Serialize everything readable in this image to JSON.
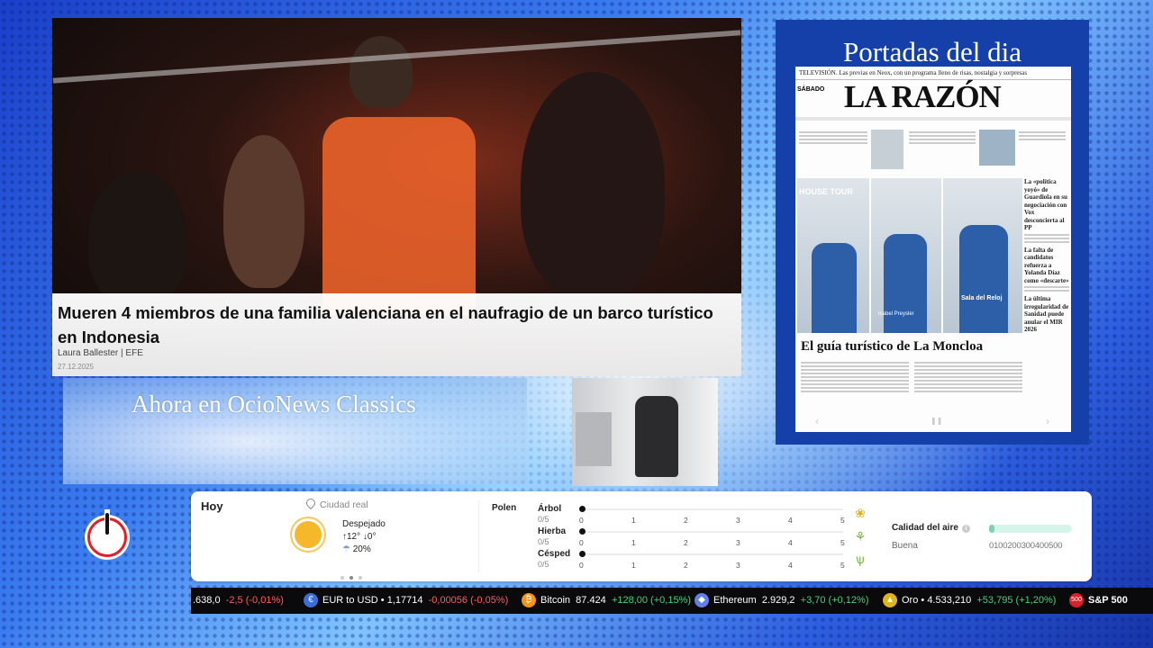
{
  "video": {
    "headline": "Mueren 4 miembros de una familia valenciana en el naufragio de un barco turístico en Indonesia",
    "author": "Laura Ballester | EFE",
    "date": "27.12.2025"
  },
  "promo": {
    "text": "Ahora en OcioNews Classics"
  },
  "newspaper": {
    "title": "Portadas del dia",
    "masthead": "LA RAZÓN",
    "day": "SÁBADO",
    "top_strip": "TELEVISIÓN. Las previas en Neox, con un programa lleno de risas, nostalgia y sorpresas",
    "main_headline": "El guía turístico de La Moncloa",
    "photo_captions": [
      "HOUSE TOUR",
      "Isabel Preysler",
      "Sala del Reloj"
    ],
    "side_stories": [
      "La «política yoyó» de Guardiola en su negociación con Vox desconcierta al PP",
      "La falta de candidatos refuerza a Yolanda Díaz como «descarte»",
      "La última irregularidad de Sanidad puede anular el MIR 2026"
    ]
  },
  "weather": {
    "today_label": "Hoy",
    "city": "Ciudad real",
    "condition": "Despejado",
    "temps": "↑12° ↓0°",
    "rain": "20%",
    "pollen_label": "Polen",
    "pollen": [
      {
        "name": "Árbol",
        "value": "0/5",
        "level": 0
      },
      {
        "name": "Hierba",
        "value": "0/5",
        "level": 0
      },
      {
        "name": "Césped",
        "value": "0/5",
        "level": 0
      }
    ],
    "pollen_ticks": [
      "0",
      "1",
      "2",
      "3",
      "4",
      "5"
    ],
    "air_quality_label": "Calidad del aire",
    "air_quality_value": "Buena",
    "air_quality_ticks": "0100200300400500"
  },
  "ticker": [
    {
      "name": "",
      "price": ".638,0",
      "change": "-2,5 (-0,01%)",
      "dir": "neg",
      "icon": "",
      "color": ""
    },
    {
      "name": "EUR to USD",
      "price": "1,17714",
      "change": "-0,00056 (-0,05%)",
      "dir": "neg",
      "icon": "currency-icon",
      "color": "#3b6fd8"
    },
    {
      "name": "Bitcoin",
      "price": "87.424",
      "change": "+128,00 (+0,15%)",
      "dir": "pos",
      "icon": "bitcoin-icon",
      "color": "#f7931a"
    },
    {
      "name": "Ethereum",
      "price": "2.929,2",
      "change": "+3,70 (+0,12%)",
      "dir": "pos",
      "icon": "ethereum-icon",
      "color": "#627eea"
    },
    {
      "name": "Oro",
      "price": "4.533,210",
      "change": "+53,795 (+1,20%)",
      "dir": "pos",
      "icon": "gold-icon",
      "color": "#e0b21b"
    },
    {
      "name": "S&P 500",
      "price": "",
      "change": "",
      "dir": "pos",
      "icon": "sp500-icon",
      "color": "#d8202a"
    }
  ]
}
